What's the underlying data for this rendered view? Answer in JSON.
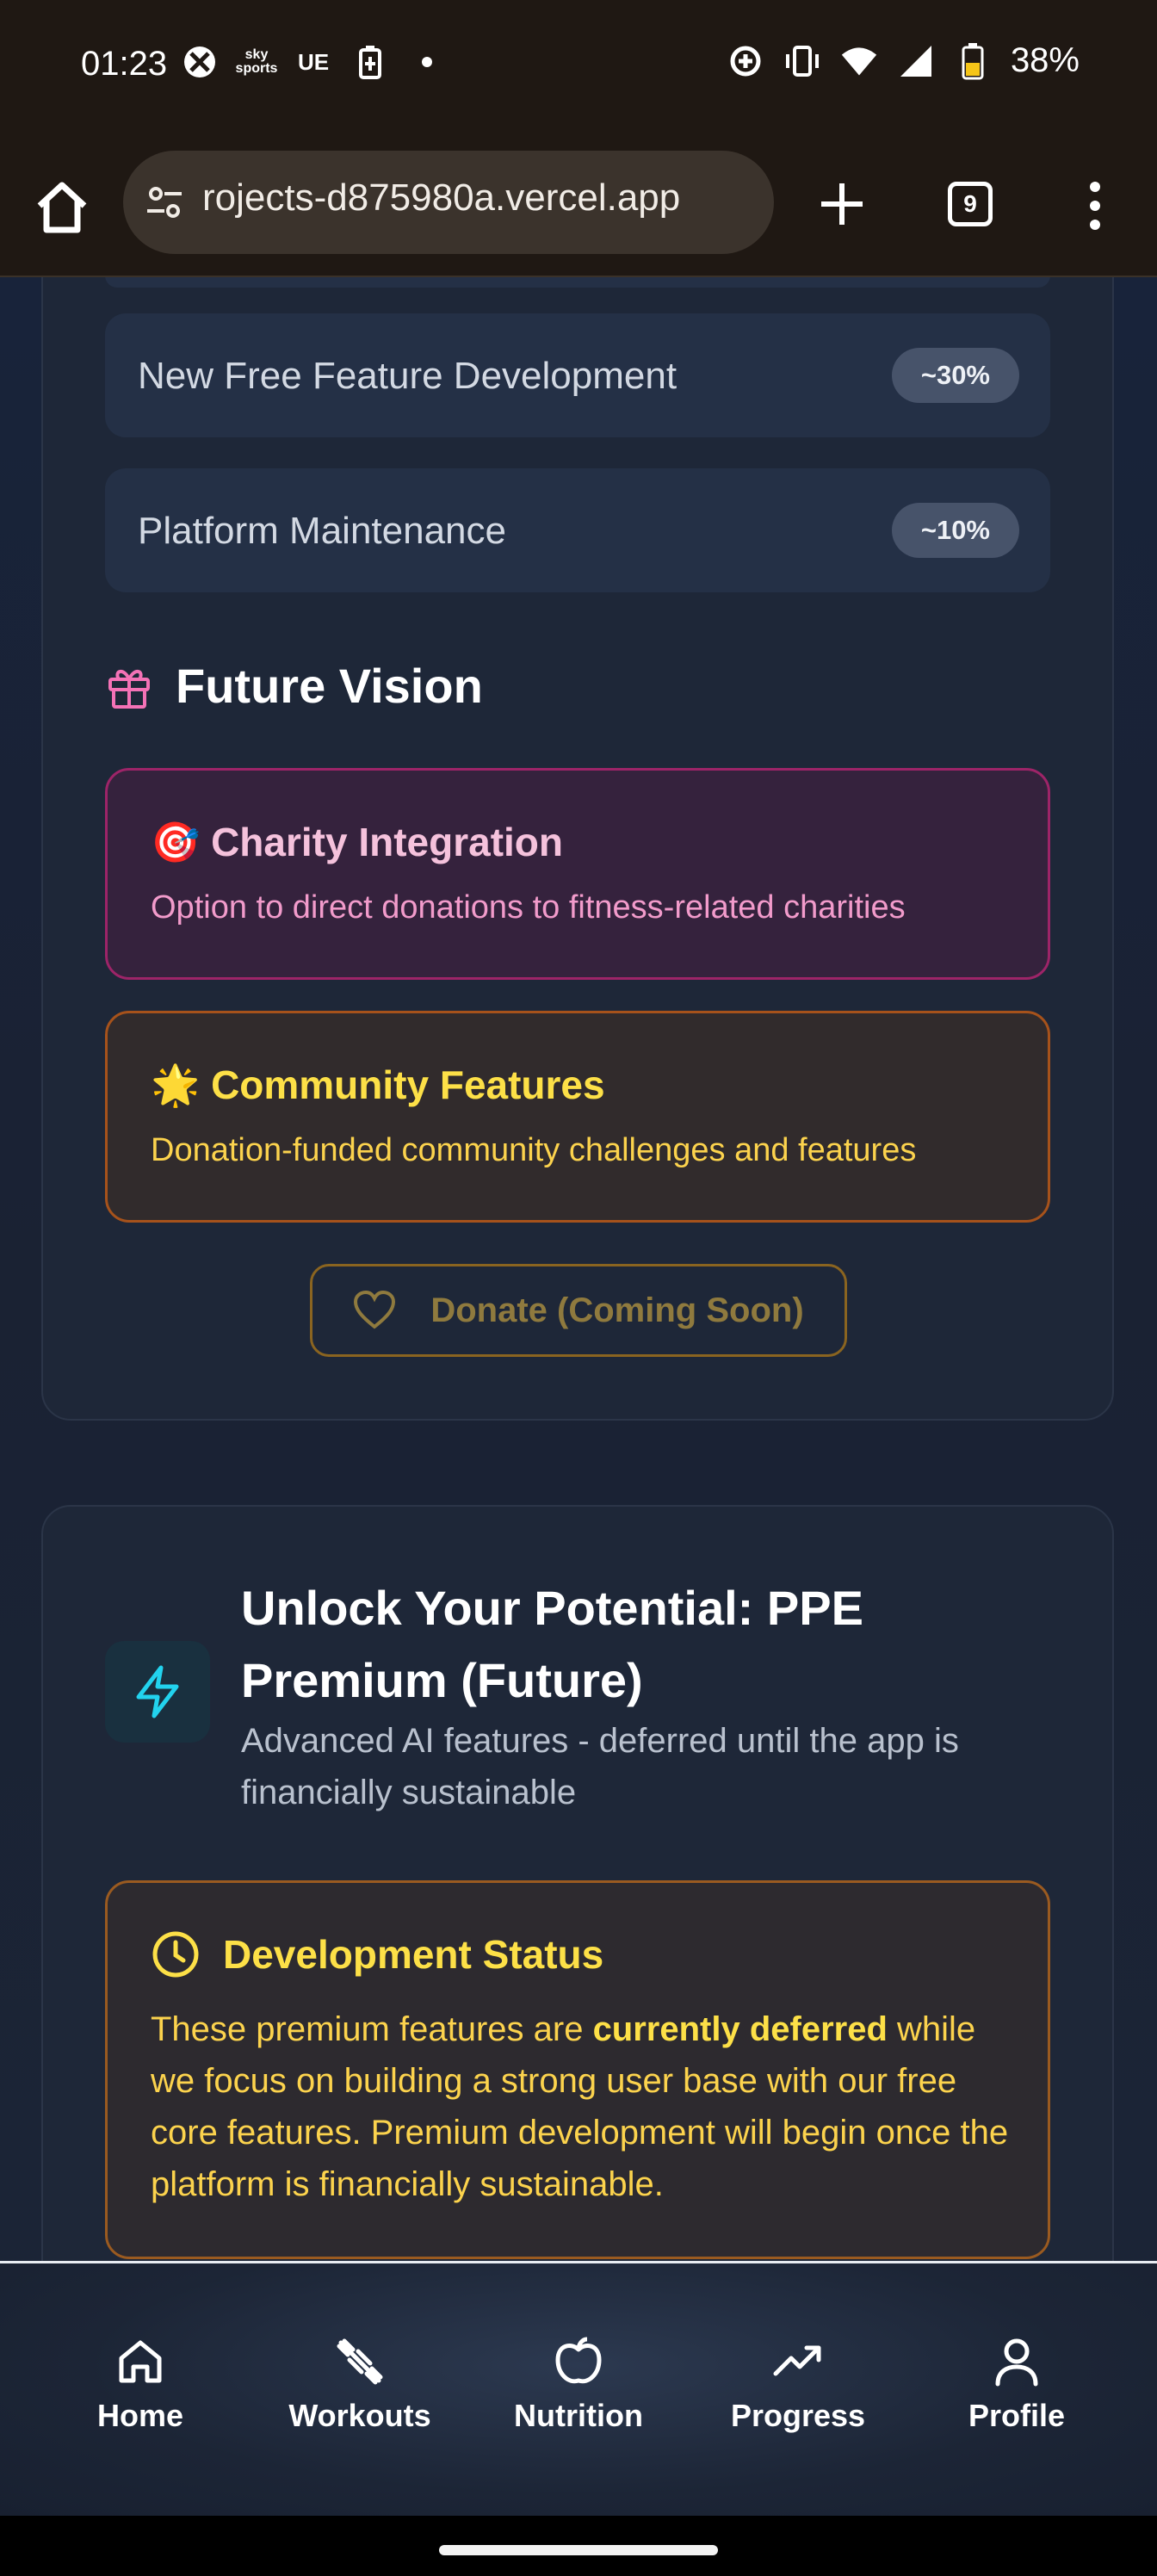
{
  "status_bar": {
    "time": "01:23",
    "notif_text_1": "sky sports",
    "notif_text_2": "UE",
    "battery": "38%"
  },
  "browser": {
    "url": "rojects-d875980a.vercel.app",
    "tab_count": "9"
  },
  "allocation": [
    {
      "label": "New Free Feature Development",
      "value": "~30%"
    },
    {
      "label": "Platform Maintenance",
      "value": "~10%"
    }
  ],
  "future_vision": {
    "title": "Future Vision",
    "items": [
      {
        "emoji": "🎯",
        "title": "Charity Integration",
        "desc": "Option to direct donations to fitness-related charities"
      },
      {
        "emoji": "🌟",
        "title": "Community Features",
        "desc": "Donation-funded community challenges and features"
      }
    ],
    "donate_label": "Donate (Coming Soon)"
  },
  "premium": {
    "title": "Unlock Your Potential: PPE Premium (Future)",
    "subtitle": "Advanced AI features - deferred until the app is financially sustainable",
    "dev_status": {
      "title": "Development Status",
      "text_before": "These premium features are ",
      "text_bold": "currently deferred",
      "text_after": " while we focus on building a strong user base with our free core features. Premium development will begin once the platform is financially sustainable."
    }
  },
  "nav": [
    {
      "label": "Home",
      "icon": "home-icon"
    },
    {
      "label": "Workouts",
      "icon": "dumbbell-icon"
    },
    {
      "label": "Nutrition",
      "icon": "apple-icon"
    },
    {
      "label": "Progress",
      "icon": "trending-up-icon"
    },
    {
      "label": "Profile",
      "icon": "user-icon"
    }
  ],
  "colors": {
    "charity_border": "#9d2468",
    "community_border": "#a6521b",
    "premium_accent": "#22d3ee",
    "status_yellow": "#fde047"
  }
}
